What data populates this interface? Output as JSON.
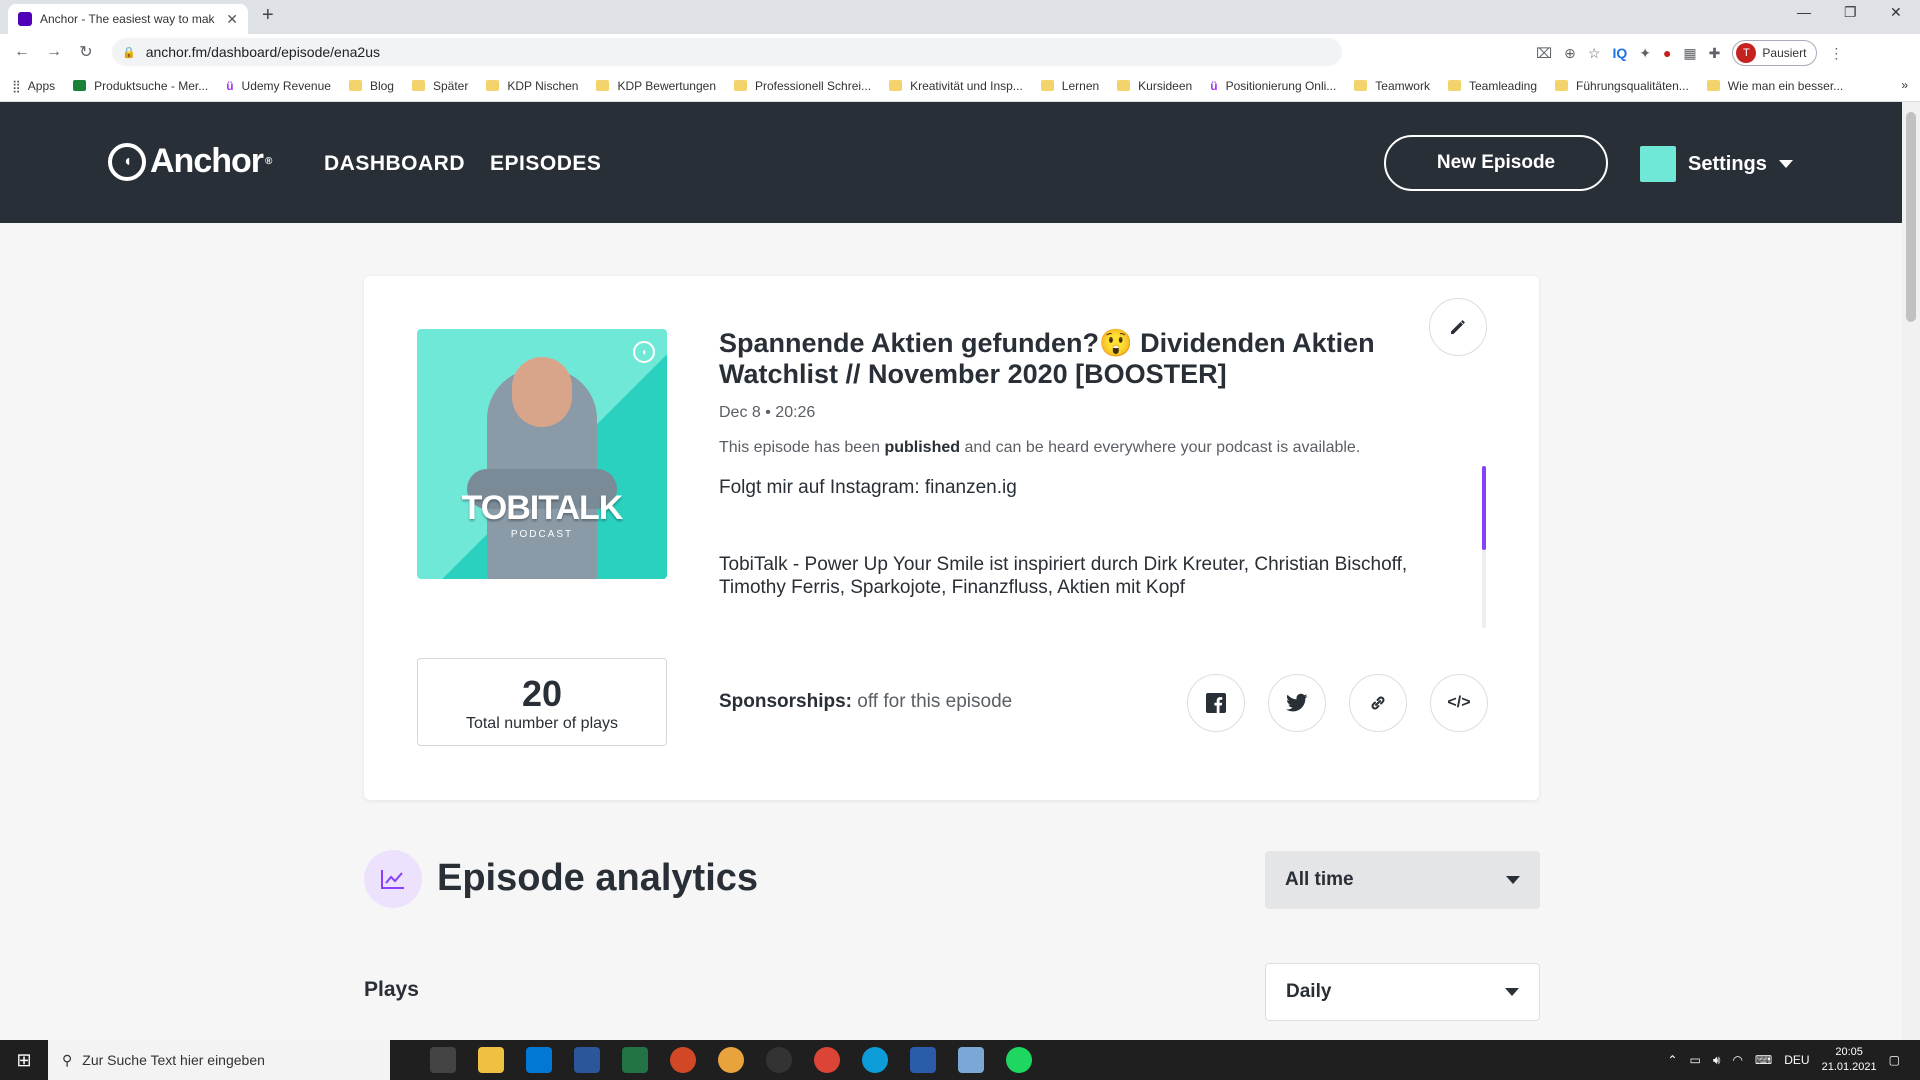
{
  "browser": {
    "tab_title": "Anchor - The easiest way to mak",
    "new_tab": "+",
    "url": "anchor.fm/dashboard/episode/ena2us",
    "profile_initial": "T",
    "profile_status": "Pausiert",
    "bookmarks": [
      {
        "label": "Apps",
        "icon": "apps-grid-icon"
      },
      {
        "label": "Produktsuche - Mer...",
        "icon": "site-favicon"
      },
      {
        "label": "Udemy Revenue",
        "icon": "udemy-icon"
      },
      {
        "label": "Blog",
        "icon": "folder-icon"
      },
      {
        "label": "Später",
        "icon": "folder-icon"
      },
      {
        "label": "KDP Nischen",
        "icon": "folder-icon"
      },
      {
        "label": "KDP Bewertungen",
        "icon": "folder-icon"
      },
      {
        "label": "Professionell Schrei...",
        "icon": "folder-icon"
      },
      {
        "label": "Kreativität und Insp...",
        "icon": "folder-icon"
      },
      {
        "label": "Lernen",
        "icon": "folder-icon"
      },
      {
        "label": "Kursideen",
        "icon": "folder-icon"
      },
      {
        "label": "Positionierung Onli...",
        "icon": "udemy-icon"
      },
      {
        "label": "Teamwork",
        "icon": "folder-icon"
      },
      {
        "label": "Teamleading",
        "icon": "folder-icon"
      },
      {
        "label": "Führungsqualitäten...",
        "icon": "folder-icon"
      },
      {
        "label": "Wie man ein besser...",
        "icon": "folder-icon"
      }
    ],
    "bookmarks_overflow": "»"
  },
  "header": {
    "logo_text": "Anchor",
    "logo_mark": "®",
    "nav": [
      "DASHBOARD",
      "EPISODES"
    ],
    "new_episode_label": "New Episode",
    "settings_label": "Settings"
  },
  "episode": {
    "art_brand": "TOBITALK",
    "art_sub": "PODCAST",
    "title": "Spannende Aktien gefunden?😲 Dividenden Aktien Watchlist // November 2020 [BOOSTER]",
    "date": "Dec 8 • 20:26",
    "status_prefix": "This episode has been ",
    "status_bold": "published",
    "status_suffix": " and can be heard everywhere your podcast is available.",
    "description": [
      "Folgt mir auf Instagram: finanzen.ig",
      "TobiTalk - Power Up Your Smile ist inspiriert durch Dirk Kreuter, Christian Bischoff, Timothy Ferris, Sparkojote, Finanzfluss, Aktien mit Kopf"
    ],
    "description_scroll_fraction": 0.52,
    "plays_count": "20",
    "plays_label": "Total number of plays",
    "sponsorships_label": "Sponsorships:",
    "sponsorships_value": " off for this episode",
    "share_icons": [
      "facebook-icon",
      "twitter-icon",
      "link-icon",
      "embed-code-icon"
    ],
    "embed_glyph": "</>"
  },
  "analytics": {
    "title": "Episode analytics",
    "range_selected": "All time",
    "plays_title": "Plays",
    "interval_selected": "Daily"
  },
  "taskbar": {
    "search_placeholder": "Zur Suche Text hier eingeben",
    "lang": "DEU",
    "time": "20:05",
    "date": "21.01.2021"
  },
  "colors": {
    "header_bg": "#292f36",
    "accent_purple": "#8940fa",
    "artwork_teal": "#6fe8d8"
  }
}
